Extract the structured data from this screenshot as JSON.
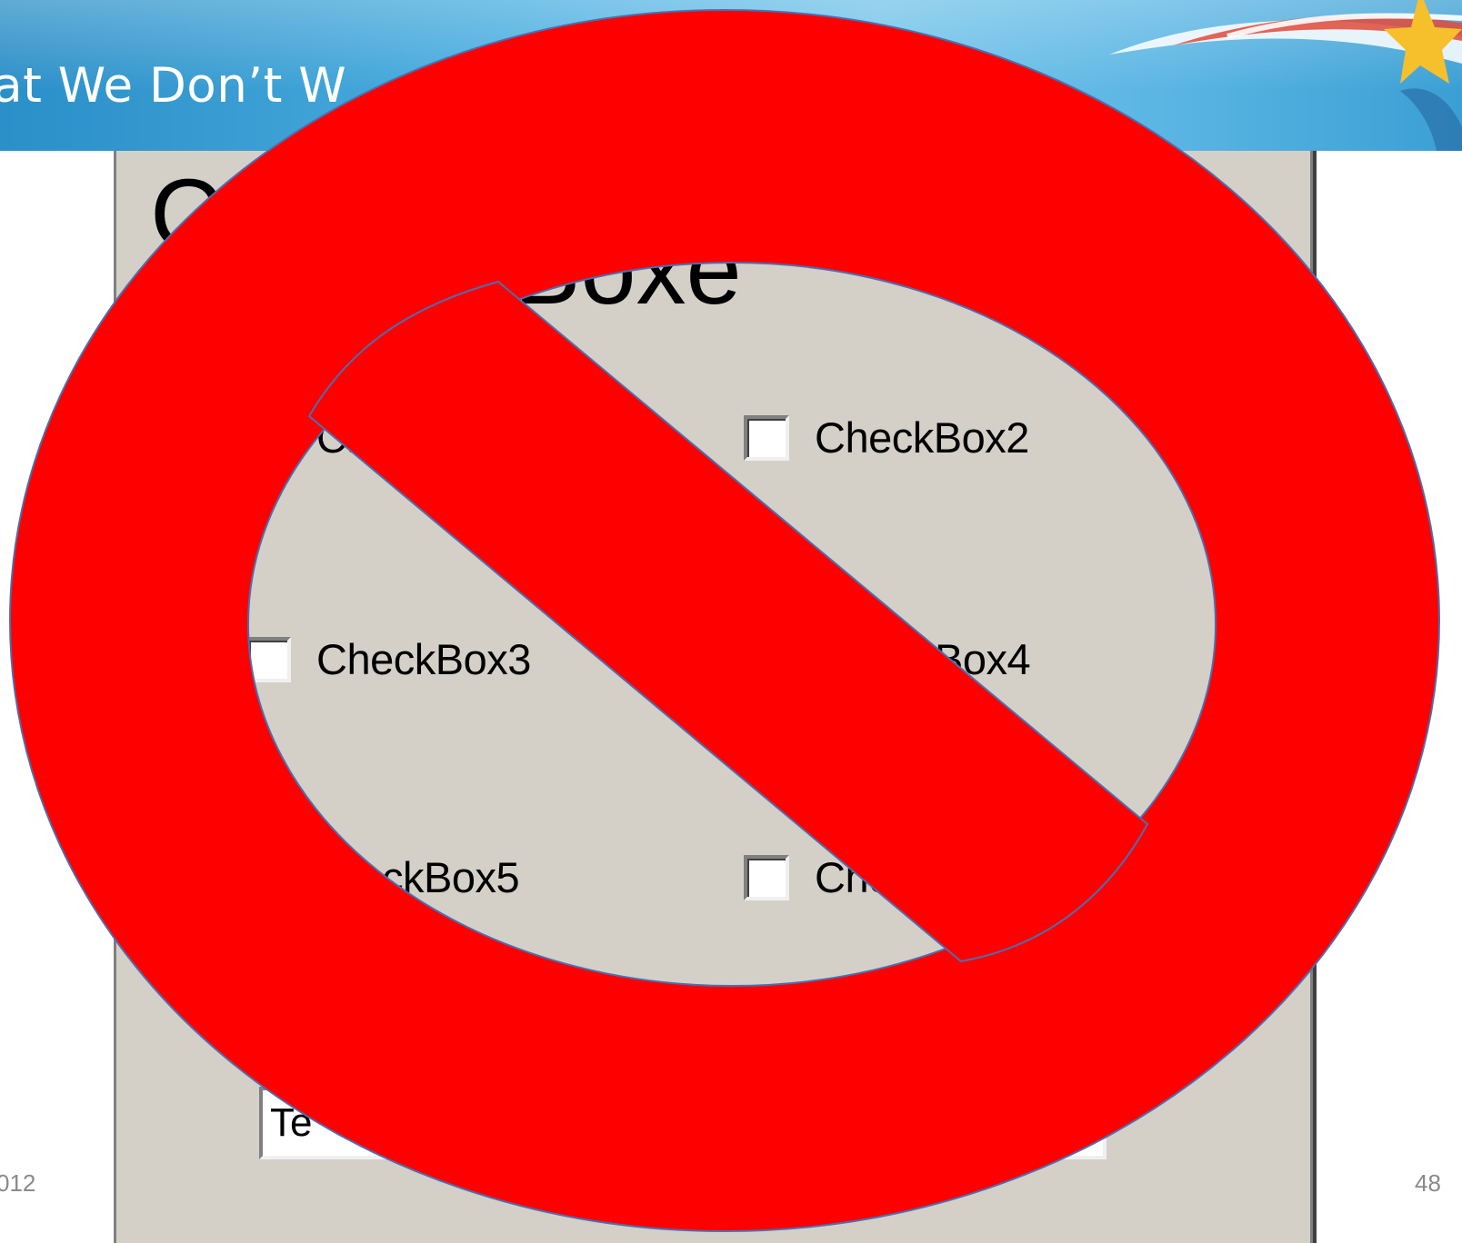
{
  "slide": {
    "title": "hat We Don’t W",
    "footer_date": "012",
    "slide_number": "48"
  },
  "form": {
    "header_visible_fragment": "C",
    "header_lower_fragment": "Boxe",
    "checkboxes": [
      {
        "label": "Ch",
        "checked": false
      },
      {
        "label": "CheckBox2",
        "checked": false
      },
      {
        "label": "CheckBox3",
        "checked": false
      },
      {
        "label": "Box4",
        "checked": false
      },
      {
        "label": "ckBox5",
        "checked": false
      },
      {
        "label": "Che",
        "checked": false
      }
    ],
    "textbox_value": "Te"
  },
  "overlay": {
    "icon": "prohibition-sign-icon",
    "color": "#ff0000"
  },
  "colors": {
    "header_blue": "#3a9fd4",
    "form_gray": "#d4d0c8",
    "prohibition_red": "#ff0000"
  }
}
